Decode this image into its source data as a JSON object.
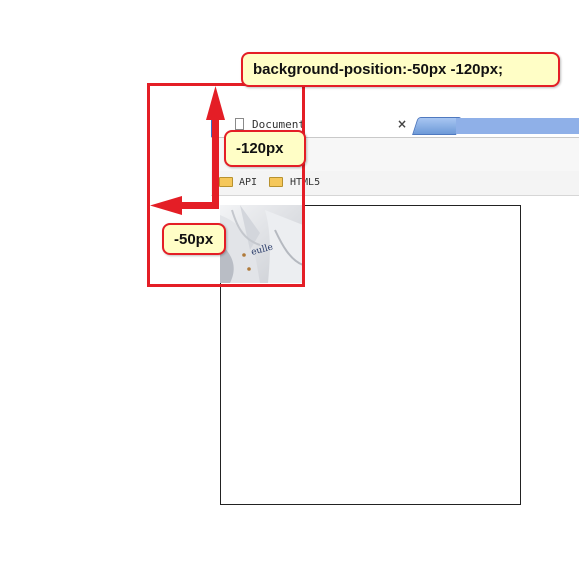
{
  "browser": {
    "tab_title": "Document",
    "close_glyph": "×",
    "bookmarks": [
      {
        "label": "API"
      },
      {
        "label": "HTML5"
      }
    ]
  },
  "annotations": {
    "css_rule": "background-position:-50px -120px;",
    "y_offset": "-120px",
    "x_offset": "-50px"
  },
  "colors": {
    "frame": "#e41e26",
    "callout_fill": "#fffec6",
    "tab_blue": "#3a6cc4"
  },
  "icons": [
    "document-icon",
    "close-icon",
    "new-tab-icon",
    "folder-icon",
    "arrow-up-icon",
    "arrow-left-icon"
  ]
}
